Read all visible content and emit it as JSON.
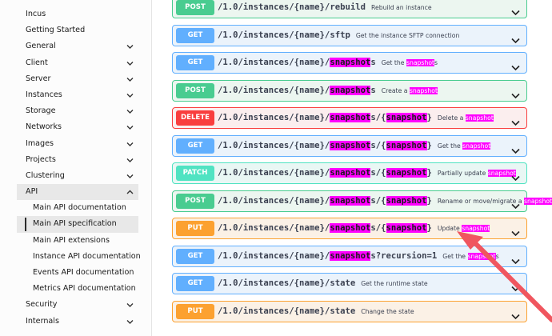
{
  "sidebar": {
    "items": [
      {
        "label": "Incus",
        "chevron": false
      },
      {
        "label": "Getting Started",
        "chevron": false
      },
      {
        "label": "General",
        "chevron": "down"
      },
      {
        "label": "Client",
        "chevron": "down"
      },
      {
        "label": "Server",
        "chevron": "down"
      },
      {
        "label": "Instances",
        "chevron": "down"
      },
      {
        "label": "Storage",
        "chevron": "down"
      },
      {
        "label": "Networks",
        "chevron": "down"
      },
      {
        "label": "Images",
        "chevron": "down"
      },
      {
        "label": "Projects",
        "chevron": "down"
      },
      {
        "label": "Clustering",
        "chevron": "down"
      },
      {
        "label": "API",
        "chevron": "up"
      },
      {
        "label": "Main API documentation",
        "chevron": false
      },
      {
        "label": "Main API specification",
        "chevron": false
      },
      {
        "label": "Main API extensions",
        "chevron": false
      },
      {
        "label": "Instance API documentation",
        "chevron": false
      },
      {
        "label": "Events API documentation",
        "chevron": false
      },
      {
        "label": "Metrics API documentation",
        "chevron": false
      },
      {
        "label": "Security",
        "chevron": "down"
      },
      {
        "label": "Internals",
        "chevron": "down"
      }
    ]
  },
  "operations": [
    {
      "method": "POST",
      "path": "/1.0/instances/{name}/rebuild",
      "summary": "Rebuild an instance"
    },
    {
      "method": "GET",
      "path": "/1.0/instances/{name}/sftp",
      "summary": "Get the instance SFTP connection"
    },
    {
      "method": "GET",
      "path": "/1.0/instances/{name}/snapshots",
      "summary": "Get the snapshots"
    },
    {
      "method": "POST",
      "path": "/1.0/instances/{name}/snapshots",
      "summary": "Create a snapshot"
    },
    {
      "method": "DELETE",
      "path": "/1.0/instances/{name}/snapshots/{snapshot}",
      "summary": "Delete a snapshot"
    },
    {
      "method": "GET",
      "path": "/1.0/instances/{name}/snapshots/{snapshot}",
      "summary": "Get the snapshot"
    },
    {
      "method": "PATCH",
      "path": "/1.0/instances/{name}/snapshots/{snapshot}",
      "summary": "Partially update snapshot"
    },
    {
      "method": "POST",
      "path": "/1.0/instances/{name}/snapshots/{snapshot}",
      "summary": "Rename or move/migrate a snapshot"
    },
    {
      "method": "PUT",
      "path": "/1.0/instances/{name}/snapshots/{snapshot}",
      "summary": "Update snapshot"
    },
    {
      "method": "GET",
      "path": "/1.0/instances/{name}/snapshots?recursion=1",
      "summary": "Get the snapshots"
    },
    {
      "method": "GET",
      "path": "/1.0/instances/{name}/state",
      "summary": "Get the runtime state"
    },
    {
      "method": "PUT",
      "path": "/1.0/instances/{name}/state",
      "summary": "Change the state"
    }
  ],
  "highlight_term": "snapshot",
  "colors": {
    "get": "#61affe",
    "post": "#49cc90",
    "delete": "#f93e3e",
    "patch": "#50e3c2",
    "put": "#fca130",
    "highlight": "#ff00ff",
    "arrow": "#f0565f"
  },
  "icons": {
    "op_expand": "chevron-down-icon",
    "nav_expand": "chevron-down-icon",
    "nav_collapse": "chevron-up-icon"
  }
}
